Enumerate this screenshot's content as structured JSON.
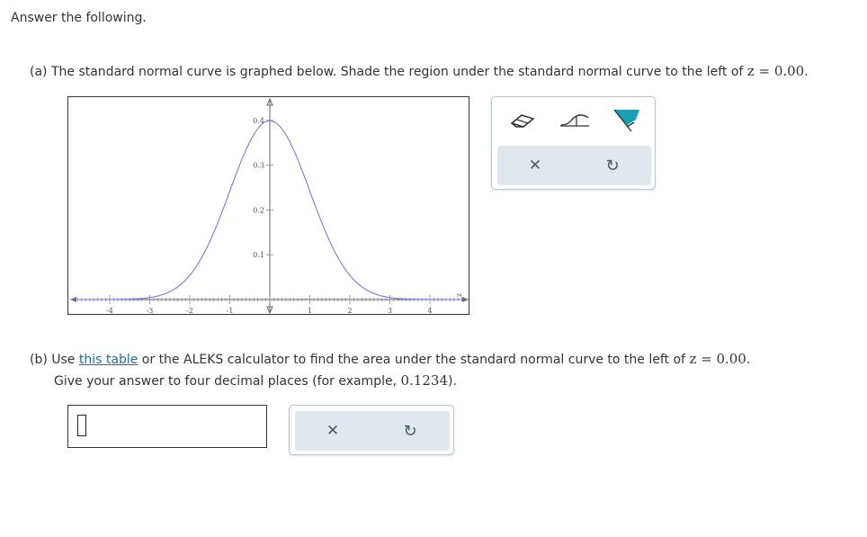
{
  "intro": "Answer the following.",
  "part_a": {
    "prefix": "(a) The standard normal curve is graphed below. Shade the region under the standard normal curve to the left of ",
    "math": "z = 0.00",
    "suffix": "."
  },
  "chart_data": {
    "type": "line",
    "function": "standard normal density",
    "xlim": [
      -5,
      5
    ],
    "ylim": [
      0,
      0.45
    ],
    "x_ticks": [
      "-4",
      "-3",
      "-2",
      "-1",
      "1",
      "2",
      "3",
      "4"
    ],
    "y_ticks": [
      "0.1",
      "0.2",
      "0.3",
      "0.4"
    ],
    "x_axis_label": "z",
    "curve_color": "#7b7bd4"
  },
  "tools": {
    "eraser": "eraser-icon",
    "tail": "left-tail-icon",
    "shade": "shade-region-icon"
  },
  "part_b": {
    "prefix": "(b) Use ",
    "link": "this table",
    "mid": " or the ALEKS calculator to find the area under the standard normal curve to the left of ",
    "math": "z = 0.00",
    "suffix": ".",
    "line2_prefix": "Give your answer to four decimal places (for example, ",
    "line2_math": "0.1234",
    "line2_suffix": ")."
  },
  "answer": {
    "value": ""
  },
  "icons": {
    "clear": "✕",
    "reset": "↻"
  },
  "colors": {
    "accent": "#1a9fb5",
    "panel_gray": "#e0e8ed",
    "link": "#1a6fa8"
  }
}
